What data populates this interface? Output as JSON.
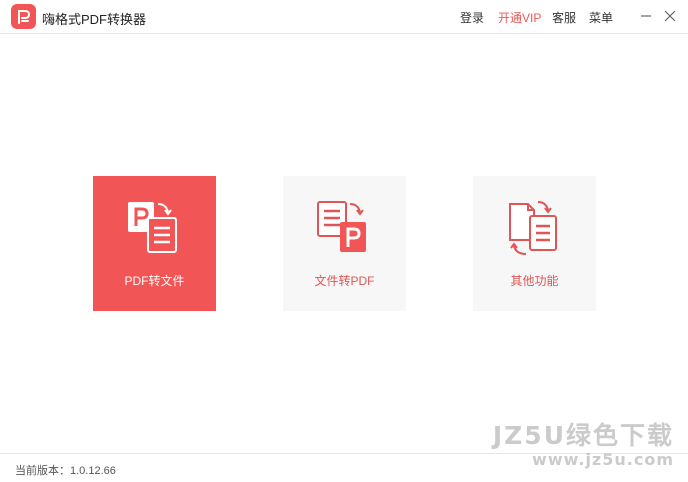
{
  "app": {
    "title": "嗨格式PDF转换器",
    "accent_color": "#f25555",
    "logo_icon": "pdf-logo-icon"
  },
  "header": {
    "nav": [
      {
        "label": "登录"
      },
      {
        "label": "开通VIP"
      },
      {
        "label": "客服"
      },
      {
        "label": "菜单"
      }
    ],
    "window_controls": {
      "minimize_icon": "minimize-icon",
      "close_icon": "close-icon"
    }
  },
  "cards": [
    {
      "label": "PDF转文件",
      "icon": "pdf-to-file-icon",
      "active": true
    },
    {
      "label": "文件转PDF",
      "icon": "file-to-pdf-icon",
      "active": false
    },
    {
      "label": "其他功能",
      "icon": "other-functions-icon",
      "active": false
    }
  ],
  "footer": {
    "version": "当前版本：1.0.12.66"
  },
  "watermark": {
    "main": "JZ5U绿色下载",
    "sub": "www.jz5u.com"
  }
}
